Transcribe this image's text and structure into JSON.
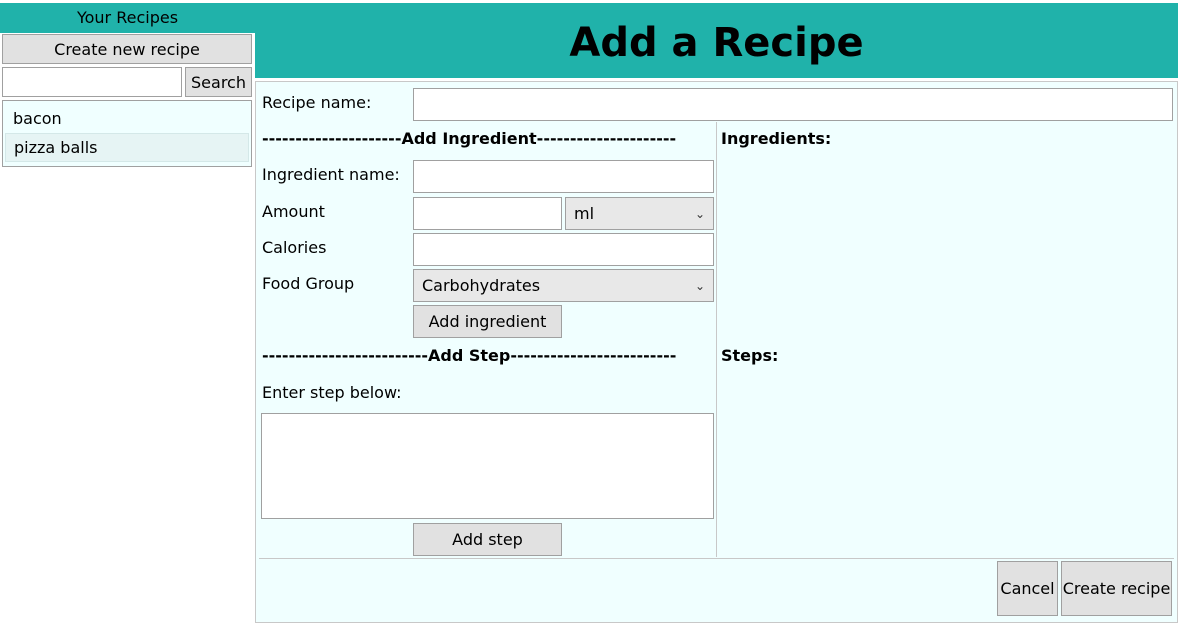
{
  "sidebar": {
    "title": "Your Recipes",
    "create_button": "Create new recipe",
    "search": {
      "value": "",
      "button": "Search"
    },
    "recipes": [
      {
        "label": "bacon",
        "selected": false
      },
      {
        "label": "pizza balls",
        "selected": true
      }
    ]
  },
  "header": {
    "title": "Add a Recipe"
  },
  "form": {
    "recipe_name_label": "Recipe name:",
    "recipe_name_value": "",
    "add_ingredient_header": "---------------------Add Ingredient---------------------",
    "ingredient_name_label": "Ingredient name:",
    "amount_label": "Amount",
    "unit_selected": "ml",
    "calories_label": "Calories",
    "food_group_label": "Food Group",
    "food_group_selected": "Carbohydrates",
    "add_ingredient_button": "Add ingredient",
    "add_step_header": "-------------------------Add Step-------------------------",
    "enter_step_label": "Enter step below:",
    "add_step_button": "Add step",
    "ingredients_header": "Ingredients:",
    "steps_header": "Steps:",
    "cancel_button": "Cancel",
    "create_button": "Create recipe"
  },
  "colors": {
    "accent": "#20b2aa",
    "panel": "#f0ffff"
  }
}
